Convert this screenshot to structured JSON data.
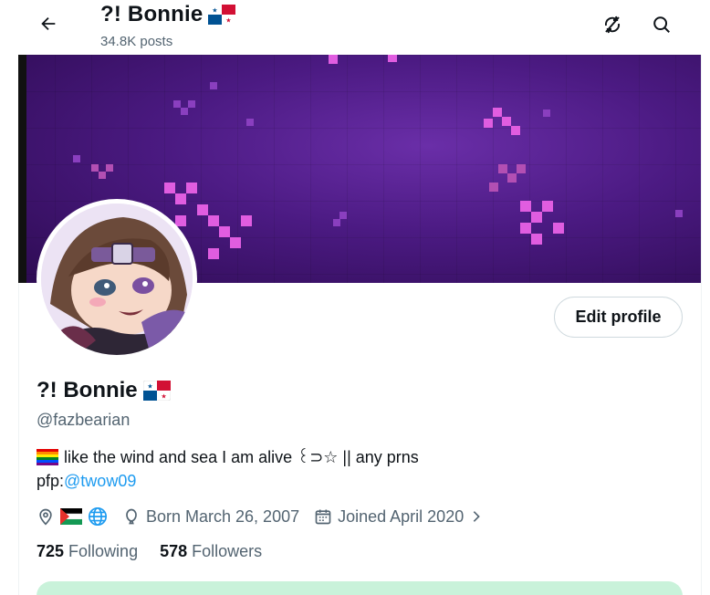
{
  "header": {
    "title": "?! Bonnie",
    "post_count": "34.8K posts"
  },
  "profile": {
    "display_name": "?! Bonnie",
    "handle": "@fazbearian",
    "bio_line1": "like the wind and sea I am alive ꒰⊃☆ || any prns",
    "bio_line2_prefix": "pfp:",
    "bio_line2_link": "@twow09",
    "born": "Born March 26, 2007",
    "joined": "Joined April 2020",
    "following_count": "725",
    "following_label": "Following",
    "followers_count": "578",
    "followers_label": "Followers"
  },
  "actions": {
    "edit_profile": "Edit profile"
  },
  "colors": {
    "link": "#1d9bf0",
    "secondary_text": "#536471",
    "banner_purple": "#4b1a82",
    "green_card": "#c9f2da"
  },
  "icons": [
    "back-arrow-icon",
    "no-sync-icon",
    "search-icon",
    "location-icon",
    "globe-icon",
    "balloon-icon",
    "calendar-icon",
    "chevron-right-icon"
  ]
}
